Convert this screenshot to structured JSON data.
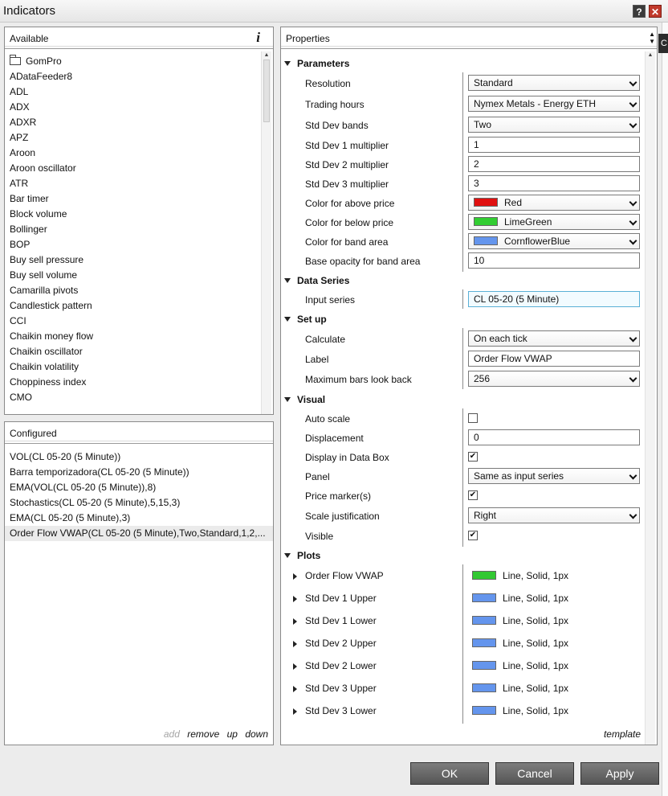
{
  "window": {
    "title": "Indicators",
    "help_label": "?",
    "close_label": "✕",
    "edge_tab_label": "C"
  },
  "available": {
    "header": "Available",
    "info_label": "i",
    "items": [
      "GomPro",
      "ADataFeeder8",
      "ADL",
      "ADX",
      "ADXR",
      "APZ",
      "Aroon",
      "Aroon oscillator",
      "ATR",
      "Bar timer",
      "Block volume",
      "Bollinger",
      "BOP",
      "Buy sell pressure",
      "Buy sell volume",
      "Camarilla pivots",
      "Candlestick pattern",
      "CCI",
      "Chaikin money flow",
      "Chaikin oscillator",
      "Chaikin volatility",
      "Choppiness index",
      "CMO"
    ]
  },
  "configured": {
    "header": "Configured",
    "items": [
      "VOL(CL 05-20 (5 Minute))",
      "Barra temporizadora(CL 05-20 (5 Minute))",
      "EMA(VOL(CL 05-20 (5 Minute)),8)",
      "Stochastics(CL 05-20 (5 Minute),5,15,3)",
      "EMA(CL 05-20 (5 Minute),3)",
      "Order Flow VWAP(CL 05-20 (5 Minute),Two,Standard,1,2,..."
    ],
    "links": {
      "add": "add",
      "remove": "remove",
      "up": "up",
      "down": "down"
    }
  },
  "properties": {
    "header": "Properties",
    "template_label": "template",
    "sections": {
      "parameters": "Parameters",
      "data_series": "Data Series",
      "setup": "Set up",
      "visual": "Visual",
      "plots": "Plots"
    },
    "parameters": {
      "resolution_label": "Resolution",
      "resolution_value": "Standard",
      "trading_hours_label": "Trading hours",
      "trading_hours_value": "Nymex Metals - Energy ETH",
      "std_dev_bands_label": "Std Dev bands",
      "std_dev_bands_value": "Two",
      "std_dev1_label": "Std Dev 1 multiplier",
      "std_dev1_value": "1",
      "std_dev2_label": "Std Dev 2 multiplier",
      "std_dev2_value": "2",
      "std_dev3_label": "Std Dev 3 multiplier",
      "std_dev3_value": "3",
      "color_above_label": "Color for above price",
      "color_above_value": "Red",
      "color_above_hex": "#e01010",
      "color_below_label": "Color for below price",
      "color_below_value": "LimeGreen",
      "color_below_hex": "#32cd32",
      "color_band_label": "Color for band area",
      "color_band_value": "CornflowerBlue",
      "color_band_hex": "#6495ed",
      "opacity_label": "Base opacity for band area",
      "opacity_value": "10"
    },
    "data_series": {
      "input_series_label": "Input series",
      "input_series_value": "CL 05-20 (5 Minute)"
    },
    "setup": {
      "calculate_label": "Calculate",
      "calculate_value": "On each tick",
      "label_label": "Label",
      "label_value": "Order Flow VWAP",
      "max_bars_label": "Maximum bars look back",
      "max_bars_value": "256"
    },
    "visual": {
      "auto_scale_label": "Auto scale",
      "auto_scale_checked": false,
      "displacement_label": "Displacement",
      "displacement_value": "0",
      "data_box_label": "Display in Data Box",
      "data_box_checked": true,
      "panel_label": "Panel",
      "panel_value": "Same as input series",
      "price_marker_label": "Price marker(s)",
      "price_marker_checked": true,
      "scale_just_label": "Scale justification",
      "scale_just_value": "Right",
      "visible_label": "Visible",
      "visible_checked": true
    },
    "plots": [
      {
        "name": "Order Flow VWAP",
        "value": "Line, Solid, 1px",
        "color": "#32c832"
      },
      {
        "name": "Std Dev 1 Upper",
        "value": "Line, Solid, 1px",
        "color": "#6495ed"
      },
      {
        "name": "Std Dev 1 Lower",
        "value": "Line, Solid, 1px",
        "color": "#6495ed"
      },
      {
        "name": "Std Dev 2 Upper",
        "value": "Line, Solid, 1px",
        "color": "#6495ed"
      },
      {
        "name": "Std Dev 2 Lower",
        "value": "Line, Solid, 1px",
        "color": "#6495ed"
      },
      {
        "name": "Std Dev 3 Upper",
        "value": "Line, Solid, 1px",
        "color": "#6495ed"
      },
      {
        "name": "Std Dev 3 Lower",
        "value": "Line, Solid, 1px",
        "color": "#6495ed"
      }
    ]
  },
  "buttons": {
    "ok": "OK",
    "cancel": "Cancel",
    "apply": "Apply"
  }
}
